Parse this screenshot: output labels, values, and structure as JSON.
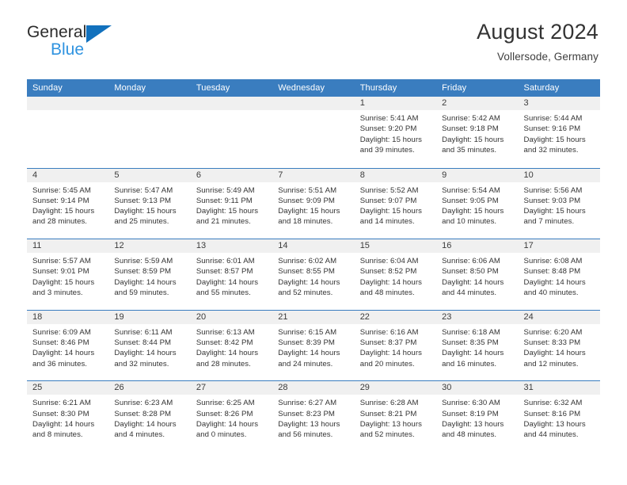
{
  "brand": {
    "name_part1": "General",
    "name_part2": "Blue",
    "triangle_color": "#1271bd",
    "blue_color": "#2f93e0"
  },
  "header": {
    "title": "August 2024",
    "location": "Vollersode, Germany"
  },
  "colors": {
    "header_blue": "#3a7dbf",
    "day_band": "#f0f0f0",
    "text": "#333333"
  },
  "calendar": {
    "day_names": [
      "Sunday",
      "Monday",
      "Tuesday",
      "Wednesday",
      "Thursday",
      "Friday",
      "Saturday"
    ],
    "weeks": [
      [
        {
          "day": "",
          "lines": []
        },
        {
          "day": "",
          "lines": []
        },
        {
          "day": "",
          "lines": []
        },
        {
          "day": "",
          "lines": []
        },
        {
          "day": "1",
          "lines": [
            "Sunrise: 5:41 AM",
            "Sunset: 9:20 PM",
            "Daylight: 15 hours",
            "and 39 minutes."
          ]
        },
        {
          "day": "2",
          "lines": [
            "Sunrise: 5:42 AM",
            "Sunset: 9:18 PM",
            "Daylight: 15 hours",
            "and 35 minutes."
          ]
        },
        {
          "day": "3",
          "lines": [
            "Sunrise: 5:44 AM",
            "Sunset: 9:16 PM",
            "Daylight: 15 hours",
            "and 32 minutes."
          ]
        }
      ],
      [
        {
          "day": "4",
          "lines": [
            "Sunrise: 5:45 AM",
            "Sunset: 9:14 PM",
            "Daylight: 15 hours",
            "and 28 minutes."
          ]
        },
        {
          "day": "5",
          "lines": [
            "Sunrise: 5:47 AM",
            "Sunset: 9:13 PM",
            "Daylight: 15 hours",
            "and 25 minutes."
          ]
        },
        {
          "day": "6",
          "lines": [
            "Sunrise: 5:49 AM",
            "Sunset: 9:11 PM",
            "Daylight: 15 hours",
            "and 21 minutes."
          ]
        },
        {
          "day": "7",
          "lines": [
            "Sunrise: 5:51 AM",
            "Sunset: 9:09 PM",
            "Daylight: 15 hours",
            "and 18 minutes."
          ]
        },
        {
          "day": "8",
          "lines": [
            "Sunrise: 5:52 AM",
            "Sunset: 9:07 PM",
            "Daylight: 15 hours",
            "and 14 minutes."
          ]
        },
        {
          "day": "9",
          "lines": [
            "Sunrise: 5:54 AM",
            "Sunset: 9:05 PM",
            "Daylight: 15 hours",
            "and 10 minutes."
          ]
        },
        {
          "day": "10",
          "lines": [
            "Sunrise: 5:56 AM",
            "Sunset: 9:03 PM",
            "Daylight: 15 hours",
            "and 7 minutes."
          ]
        }
      ],
      [
        {
          "day": "11",
          "lines": [
            "Sunrise: 5:57 AM",
            "Sunset: 9:01 PM",
            "Daylight: 15 hours",
            "and 3 minutes."
          ]
        },
        {
          "day": "12",
          "lines": [
            "Sunrise: 5:59 AM",
            "Sunset: 8:59 PM",
            "Daylight: 14 hours",
            "and 59 minutes."
          ]
        },
        {
          "day": "13",
          "lines": [
            "Sunrise: 6:01 AM",
            "Sunset: 8:57 PM",
            "Daylight: 14 hours",
            "and 55 minutes."
          ]
        },
        {
          "day": "14",
          "lines": [
            "Sunrise: 6:02 AM",
            "Sunset: 8:55 PM",
            "Daylight: 14 hours",
            "and 52 minutes."
          ]
        },
        {
          "day": "15",
          "lines": [
            "Sunrise: 6:04 AM",
            "Sunset: 8:52 PM",
            "Daylight: 14 hours",
            "and 48 minutes."
          ]
        },
        {
          "day": "16",
          "lines": [
            "Sunrise: 6:06 AM",
            "Sunset: 8:50 PM",
            "Daylight: 14 hours",
            "and 44 minutes."
          ]
        },
        {
          "day": "17",
          "lines": [
            "Sunrise: 6:08 AM",
            "Sunset: 8:48 PM",
            "Daylight: 14 hours",
            "and 40 minutes."
          ]
        }
      ],
      [
        {
          "day": "18",
          "lines": [
            "Sunrise: 6:09 AM",
            "Sunset: 8:46 PM",
            "Daylight: 14 hours",
            "and 36 minutes."
          ]
        },
        {
          "day": "19",
          "lines": [
            "Sunrise: 6:11 AM",
            "Sunset: 8:44 PM",
            "Daylight: 14 hours",
            "and 32 minutes."
          ]
        },
        {
          "day": "20",
          "lines": [
            "Sunrise: 6:13 AM",
            "Sunset: 8:42 PM",
            "Daylight: 14 hours",
            "and 28 minutes."
          ]
        },
        {
          "day": "21",
          "lines": [
            "Sunrise: 6:15 AM",
            "Sunset: 8:39 PM",
            "Daylight: 14 hours",
            "and 24 minutes."
          ]
        },
        {
          "day": "22",
          "lines": [
            "Sunrise: 6:16 AM",
            "Sunset: 8:37 PM",
            "Daylight: 14 hours",
            "and 20 minutes."
          ]
        },
        {
          "day": "23",
          "lines": [
            "Sunrise: 6:18 AM",
            "Sunset: 8:35 PM",
            "Daylight: 14 hours",
            "and 16 minutes."
          ]
        },
        {
          "day": "24",
          "lines": [
            "Sunrise: 6:20 AM",
            "Sunset: 8:33 PM",
            "Daylight: 14 hours",
            "and 12 minutes."
          ]
        }
      ],
      [
        {
          "day": "25",
          "lines": [
            "Sunrise: 6:21 AM",
            "Sunset: 8:30 PM",
            "Daylight: 14 hours",
            "and 8 minutes."
          ]
        },
        {
          "day": "26",
          "lines": [
            "Sunrise: 6:23 AM",
            "Sunset: 8:28 PM",
            "Daylight: 14 hours",
            "and 4 minutes."
          ]
        },
        {
          "day": "27",
          "lines": [
            "Sunrise: 6:25 AM",
            "Sunset: 8:26 PM",
            "Daylight: 14 hours",
            "and 0 minutes."
          ]
        },
        {
          "day": "28",
          "lines": [
            "Sunrise: 6:27 AM",
            "Sunset: 8:23 PM",
            "Daylight: 13 hours",
            "and 56 minutes."
          ]
        },
        {
          "day": "29",
          "lines": [
            "Sunrise: 6:28 AM",
            "Sunset: 8:21 PM",
            "Daylight: 13 hours",
            "and 52 minutes."
          ]
        },
        {
          "day": "30",
          "lines": [
            "Sunrise: 6:30 AM",
            "Sunset: 8:19 PM",
            "Daylight: 13 hours",
            "and 48 minutes."
          ]
        },
        {
          "day": "31",
          "lines": [
            "Sunrise: 6:32 AM",
            "Sunset: 8:16 PM",
            "Daylight: 13 hours",
            "and 44 minutes."
          ]
        }
      ]
    ]
  }
}
